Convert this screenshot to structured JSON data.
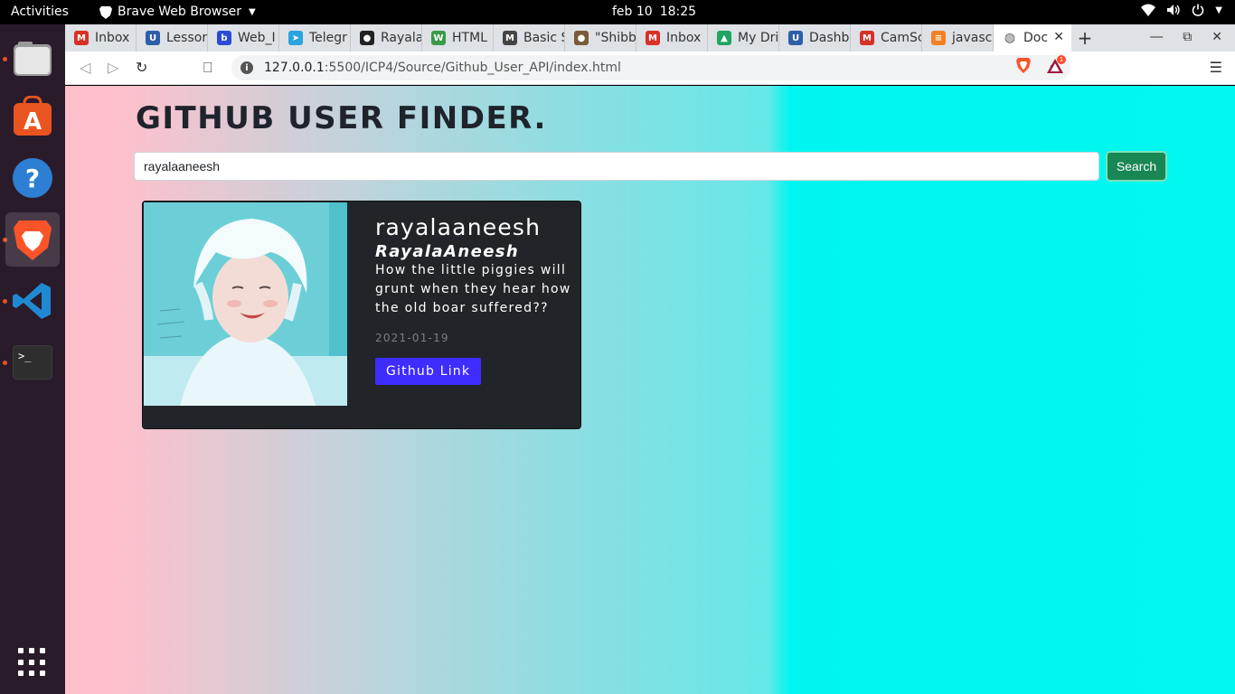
{
  "topbar": {
    "activities": "Activities",
    "app_name": "Brave Web Browser",
    "date": "feb 10",
    "time": "18:25"
  },
  "dock": {
    "items": [
      "files-icon",
      "software-icon",
      "help-icon",
      "brave-icon",
      "vscode-icon",
      "terminal-icon"
    ],
    "active": "brave-icon"
  },
  "tabs": [
    {
      "label": "Inbox",
      "icon": "gmail-icon",
      "color": "#d93025"
    },
    {
      "label": "Lessor",
      "icon": "umkc-icon",
      "color": "#2d5fa8"
    },
    {
      "label": "Web_I",
      "icon": "box-icon",
      "color": "#2a4bd6"
    },
    {
      "label": "Telegr",
      "icon": "telegram-icon",
      "color": "#2aa3e0"
    },
    {
      "label": "Rayala",
      "icon": "github-icon",
      "color": "#222222"
    },
    {
      "label": "HTML",
      "icon": "w3schools-icon",
      "color": "#3a9a4a"
    },
    {
      "label": "Basic S",
      "icon": "markdown-icon",
      "color": "#444444"
    },
    {
      "label": "\"Shibb",
      "icon": "avatar-icon",
      "color": "#7a5a3a"
    },
    {
      "label": "Inbox",
      "icon": "gmail-icon",
      "color": "#d93025"
    },
    {
      "label": "My Dri",
      "icon": "drive-icon",
      "color": "#1fa463"
    },
    {
      "label": "Dashb",
      "icon": "umkc-icon",
      "color": "#2d5fa8"
    },
    {
      "label": "CamSc",
      "icon": "gmail-icon",
      "color": "#d93025"
    },
    {
      "label": "javasc",
      "icon": "stackoverflow-icon",
      "color": "#f48024"
    }
  ],
  "active_tab": {
    "label": "Doc",
    "icon": "globe-icon"
  },
  "url": {
    "host": "127.0.0.1",
    "path": ":5500/ICP4/Source/Github_User_API/index.html"
  },
  "page": {
    "title": "GITHUB USER FINDER.",
    "search_value": "rayalaaneesh",
    "search_button": "Search"
  },
  "card": {
    "login": "rayalaaneesh",
    "name": "RayalaAneesh",
    "bio": "How the little piggies will grunt when they hear how the old boar suffered??",
    "created": "2021-01-19",
    "link_label": "Github Link"
  },
  "rewards_count": "1"
}
